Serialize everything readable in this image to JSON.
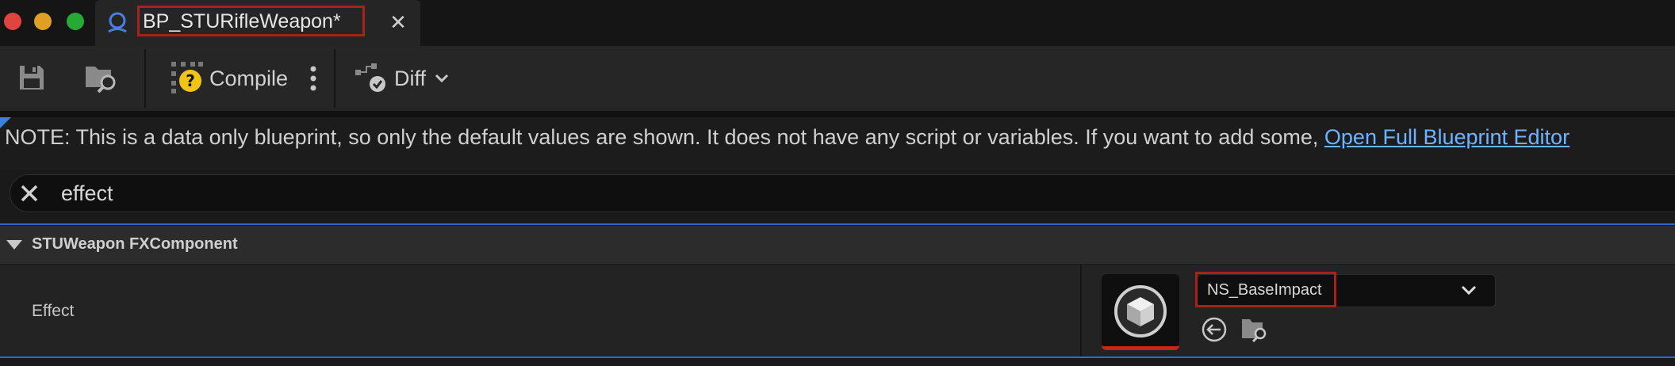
{
  "window": {
    "tab_title": "BP_STURifleWeapon*",
    "tab_close": "✕"
  },
  "toolbar": {
    "save_icon": "save-icon",
    "browse_icon": "folder-search-icon",
    "compile_label": "Compile",
    "compile_status": "unknown",
    "diff_label": "Diff"
  },
  "note": {
    "text": "NOTE: This is a data only blueprint, so only the default values are shown.  It does not have any script or variables.  If you want to add some,",
    "link": "Open Full Blueprint Editor"
  },
  "search": {
    "value": "effect"
  },
  "details": {
    "category_label": "STUWeapon FXComponent",
    "property_label": "Effect",
    "asset_value": "NS_BaseImpact"
  },
  "colors": {
    "accent": "#2a6ad0",
    "highlight_red": "#a8211b",
    "link": "#6cb4ff",
    "compile_warning": "#f0c419"
  }
}
